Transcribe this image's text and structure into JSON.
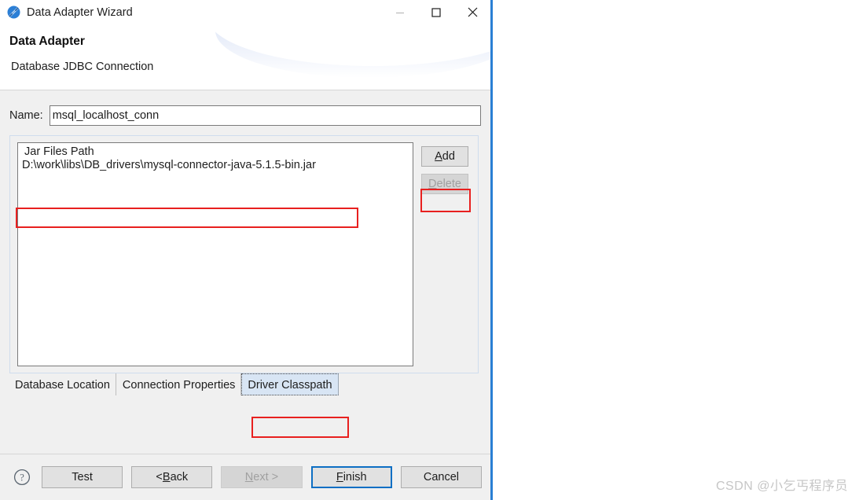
{
  "window": {
    "title": "Data Adapter Wizard",
    "icon": "data-adapter-icon",
    "controls": {
      "minimize": "minimize-icon",
      "maximize": "maximize-icon",
      "close": "close-icon"
    }
  },
  "header": {
    "title": "Data Adapter",
    "subtitle": "Database JDBC Connection"
  },
  "form": {
    "name_label": "Name:",
    "name_value": "msql_localhost_conn",
    "name_placeholder": ""
  },
  "classpath": {
    "list_header": "Jar Files Path",
    "entries": [
      "D:\\work\\libs\\DB_drivers\\mysql-connector-java-5.1.5-bin.jar"
    ],
    "add_button": "Add",
    "add_mnemonic": "A",
    "delete_button": "Delete",
    "delete_mnemonic": "D",
    "delete_enabled": false
  },
  "tabs": [
    {
      "label": "Database Location",
      "selected": false
    },
    {
      "label": "Connection Properties",
      "selected": false
    },
    {
      "label": "Driver Classpath",
      "selected": true
    }
  ],
  "footer": {
    "help": "?",
    "buttons": [
      {
        "label": "Test",
        "mnemonic": "",
        "state": "enabled"
      },
      {
        "label": "< Back",
        "mnemonic": "B",
        "state": "enabled"
      },
      {
        "label": "Next >",
        "mnemonic": "N",
        "state": "disabled"
      },
      {
        "label": "Finish",
        "mnemonic": "F",
        "state": "default"
      },
      {
        "label": "Cancel",
        "mnemonic": "",
        "state": "enabled"
      }
    ]
  },
  "annotations": {
    "color": "#e8201f",
    "targets": [
      "jar-path-entry",
      "add-button",
      "driver-classpath-tab"
    ]
  },
  "watermark": "CSDN @小乞丐程序员"
}
